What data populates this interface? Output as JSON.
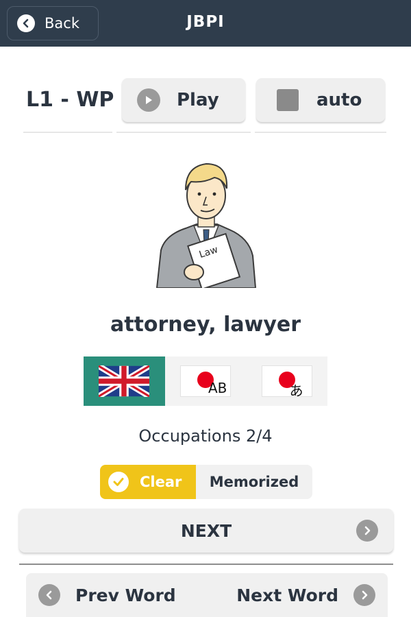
{
  "header": {
    "back_label": "Back",
    "title": "JBPI"
  },
  "controls": {
    "lesson": "L1 - WP",
    "play_label": "Play",
    "auto_label": "auto"
  },
  "card": {
    "image": "lawyer-illustration",
    "image_text": "Law",
    "word": "attorney, lawyer"
  },
  "languages": {
    "selected": "english",
    "options": [
      {
        "id": "english",
        "icon": "uk-flag-icon"
      },
      {
        "id": "romaji",
        "icon": "japan-flag-icon",
        "text": "AB"
      },
      {
        "id": "hiragana",
        "icon": "japan-flag-icon",
        "text": "あ"
      }
    ]
  },
  "category": "Occupations 2/4",
  "status_toggle": {
    "clear_label": "Clear",
    "memorized_label": "Memorized",
    "selected": "clear"
  },
  "next_label": "NEXT",
  "nav": {
    "prev_label": "Prev Word",
    "next_label": "Next Word"
  },
  "colors": {
    "header_bg": "#2f3d4c",
    "accent_green": "#2a8f7b",
    "accent_yellow": "#f0c419",
    "text_dark": "#2b3440"
  }
}
